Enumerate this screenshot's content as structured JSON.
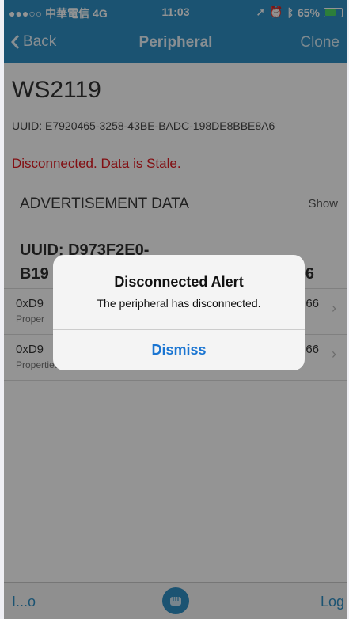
{
  "status_bar": {
    "carrier": "●●●○○ 中華電信  4G",
    "time": "11:03",
    "battery": "65%",
    "battery_level": 0.65
  },
  "nav": {
    "back_label": "Back",
    "title": "Peripheral",
    "clone_label": "Clone"
  },
  "peripheral": {
    "name": "WS2119",
    "uuid": "UUID: E7920465-3258-43BE-BADC-198DE8BBE8A6",
    "status": "Disconnected. Data is Stale."
  },
  "advertisement": {
    "header": "ADVERTISEMENT DATA",
    "show_label": "Show"
  },
  "service": {
    "uuid_line1": "UUID: D973F2E0-",
    "uuid_line2_start": "B19",
    "uuid_line2_end": "66"
  },
  "characteristics": [
    {
      "uuid_start": "0xD9",
      "uuid_end": "66",
      "properties": "Proper"
    },
    {
      "uuid_start": "0xD9",
      "uuid_end": "66",
      "properties": "Properties: Write"
    }
  ],
  "tab_bar": {
    "left_label": "I...o",
    "right_label": "Log"
  },
  "alert": {
    "title": "Disconnected Alert",
    "message": "The peripheral has disconnected.",
    "button_label": "Dismiss"
  },
  "colors": {
    "nav_bar": "#2f8fc4",
    "status_error": "#e0191f",
    "alert_button": "#1a75d2"
  }
}
